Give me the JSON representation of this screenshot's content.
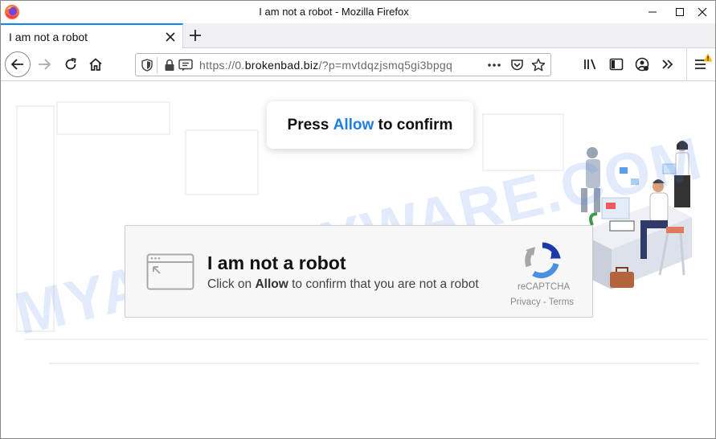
{
  "window": {
    "title": "I am not a robot - Mozilla Firefox"
  },
  "tabs": [
    {
      "label": "I am not a robot",
      "active": true
    }
  ],
  "urlbar": {
    "scheme": "https://0.",
    "domain": "brokenbad.biz",
    "path": "/?p=mvtdqzjsmq5gi3bpgq"
  },
  "page": {
    "prompt": {
      "before": "Press ",
      "highlight": "Allow",
      "after": " to confirm"
    },
    "captcha": {
      "title": "I am not a robot",
      "subtitle_before": "Click on ",
      "subtitle_bold": "Allow",
      "subtitle_after": " to confirm that you are not a robot",
      "brand": "reCAPTCHA",
      "links": "Privacy - Terms"
    },
    "watermark": "MYANTISPYWARE.COM"
  },
  "colors": {
    "accent": "#0a84ff",
    "allow_blue": "#1e7ee5",
    "recaptcha_blue": "#4a90e2",
    "recaptcha_gray": "#a6a6a6"
  },
  "icons": [
    "firefox-logo",
    "minimize-icon",
    "maximize-icon",
    "close-icon",
    "tab-close-icon",
    "new-tab-icon",
    "back-icon",
    "forward-icon",
    "reload-icon",
    "home-icon",
    "shield-icon",
    "lock-icon",
    "permissions-icon",
    "page-actions-icon",
    "pocket-icon",
    "bookmark-star-icon",
    "library-icon",
    "sidebar-icon",
    "account-icon",
    "overflow-icon",
    "menu-icon",
    "update-warning-icon",
    "window-icon",
    "recaptcha-icon"
  ]
}
